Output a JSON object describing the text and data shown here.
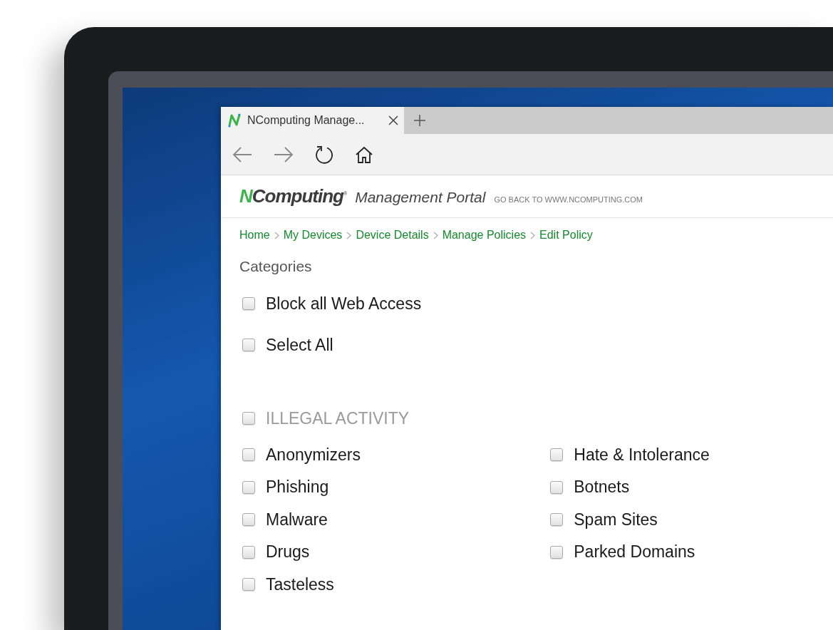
{
  "browser": {
    "tab": {
      "title": "NComputing Manage...",
      "selected": true
    }
  },
  "header": {
    "logo": "NComputing$^{®}$",
    "title": "Management Portal",
    "link": "GO BACK TO WWW.NCOMPUTING.COM"
  },
  "breadcrumbs": [
    "Home",
    "My Devices",
    "Device Details",
    "Manage Policies",
    "Edit Policy"
  ],
  "heading": "Categories",
  "options": [
    {
      "label": "Block all Web Access",
      "checked": false
    },
    {
      "label": "Select All",
      "checked": false
    }
  ],
  "group": {
    "label": "ILLEGAL ACTIVITY",
    "checked": false,
    "columns": [
      [
        {
          "label": "Anonymizers",
          "checked": false
        },
        {
          "label": "Phishing",
          "checked": false
        },
        {
          "label": "Malware",
          "checked": false
        },
        {
          "label": "Drugs",
          "checked": false
        },
        {
          "label": "Tasteless",
          "checked": false
        }
      ],
      [
        {
          "label": "Hate & Intolerance",
          "checked": false
        },
        {
          "label": "Botnets",
          "checked": false
        },
        {
          "label": "Spam Sites",
          "checked": false
        },
        {
          "label": "Parked Domains",
          "checked": false
        }
      ]
    ]
  }
}
